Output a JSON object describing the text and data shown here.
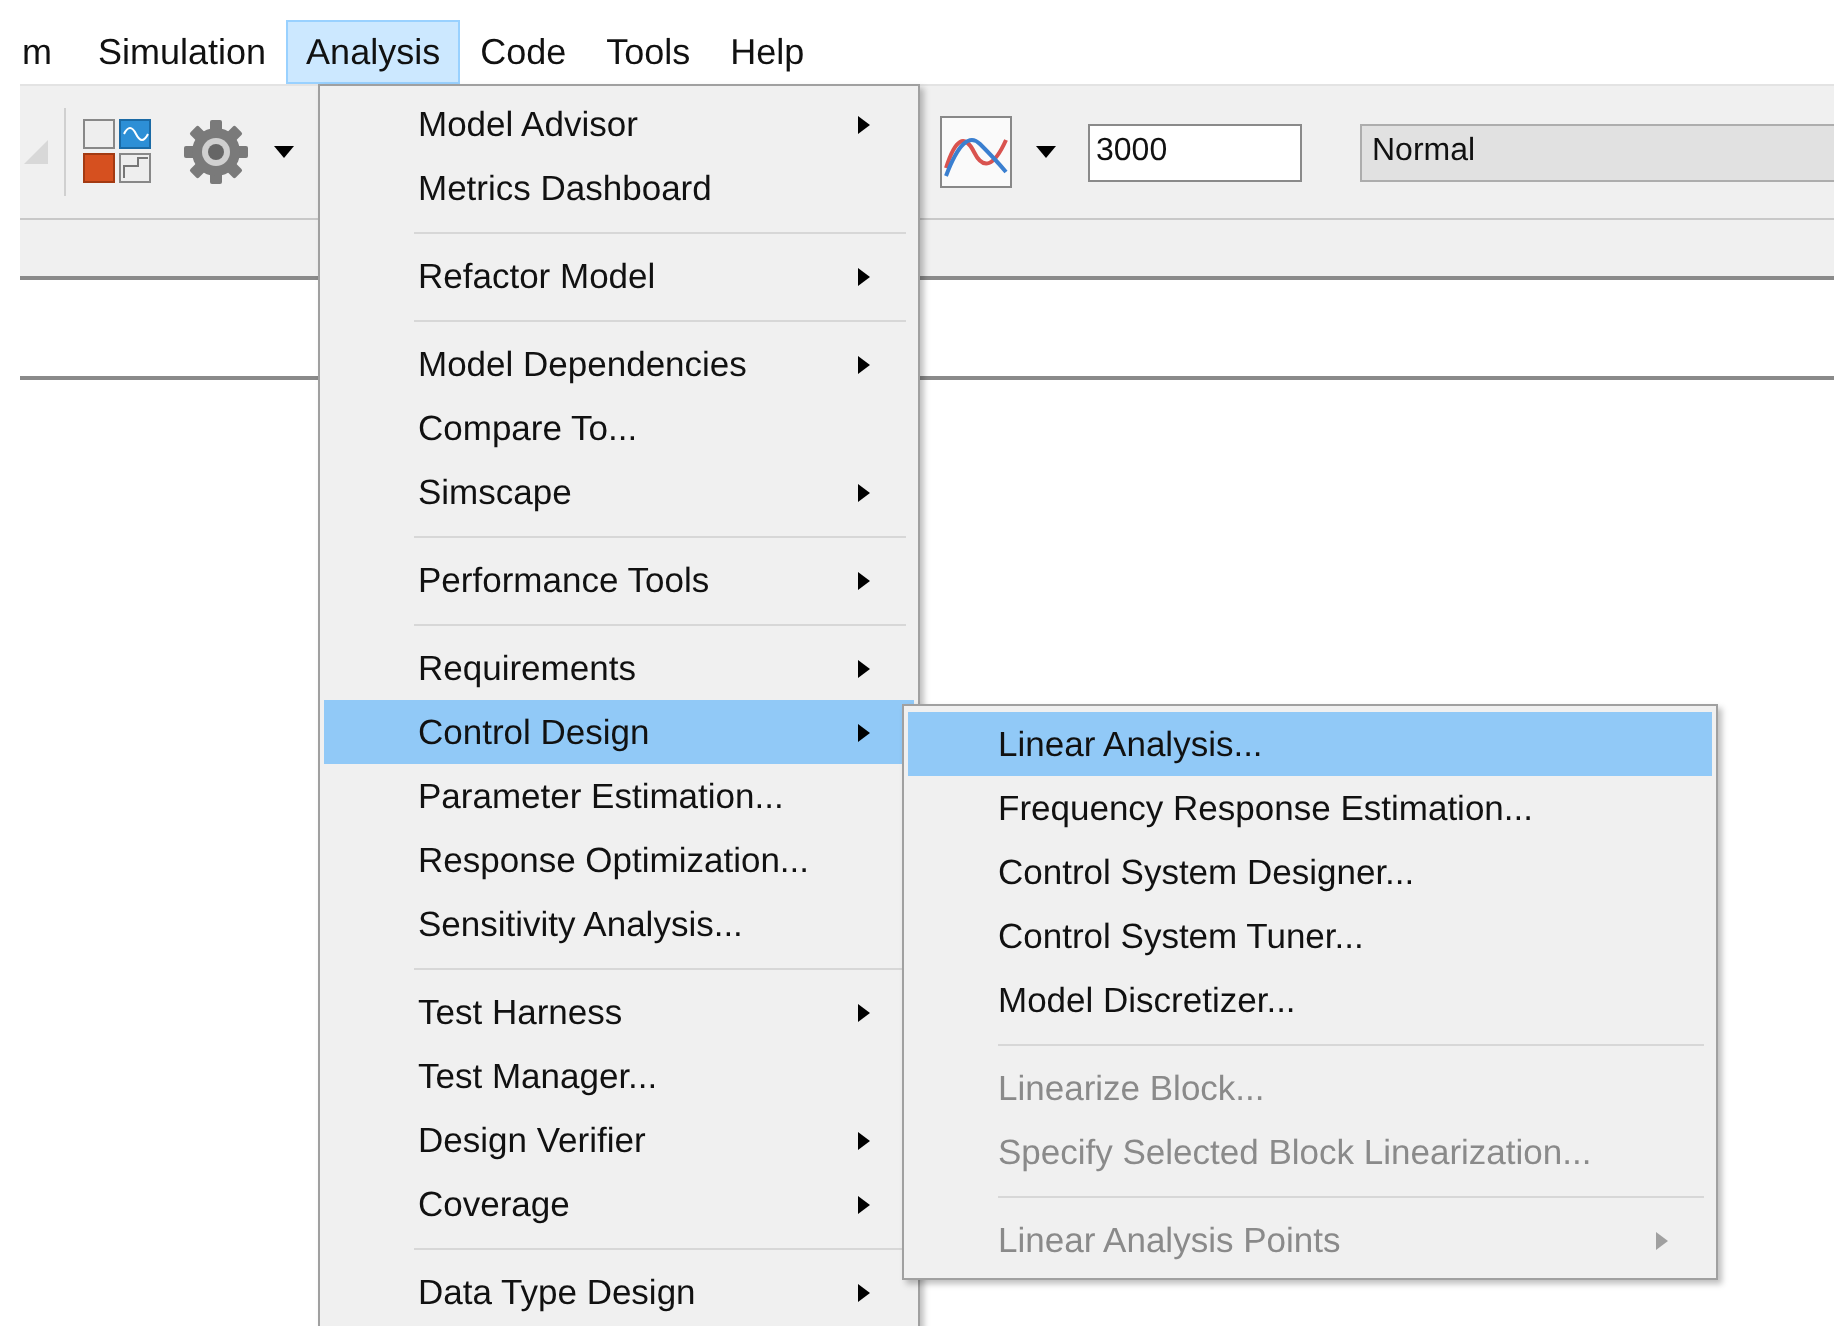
{
  "menubar": [
    {
      "label": "m",
      "selected": false
    },
    {
      "label": "Simulation",
      "selected": false
    },
    {
      "label": "Analysis",
      "selected": true
    },
    {
      "label": "Code",
      "selected": false
    },
    {
      "label": "Tools",
      "selected": false
    },
    {
      "label": "Help",
      "selected": false
    }
  ],
  "toolbar": {
    "stop_time": "3000",
    "simulation_mode": "Normal"
  },
  "menu": {
    "groups": [
      [
        {
          "label": "Model Advisor",
          "submenu": true,
          "selected": false,
          "disabled": false
        },
        {
          "label": "Metrics Dashboard",
          "submenu": false,
          "selected": false,
          "disabled": false
        }
      ],
      [
        {
          "label": "Refactor Model",
          "submenu": true,
          "selected": false,
          "disabled": false
        }
      ],
      [
        {
          "label": "Model Dependencies",
          "submenu": true,
          "selected": false,
          "disabled": false
        },
        {
          "label": "Compare To...",
          "submenu": false,
          "selected": false,
          "disabled": false
        },
        {
          "label": "Simscape",
          "submenu": true,
          "selected": false,
          "disabled": false
        }
      ],
      [
        {
          "label": "Performance Tools",
          "submenu": true,
          "selected": false,
          "disabled": false
        }
      ],
      [
        {
          "label": "Requirements",
          "submenu": true,
          "selected": false,
          "disabled": false
        },
        {
          "label": "Control Design",
          "submenu": true,
          "selected": true,
          "disabled": false
        },
        {
          "label": "Parameter Estimation...",
          "submenu": false,
          "selected": false,
          "disabled": false
        },
        {
          "label": "Response Optimization...",
          "submenu": false,
          "selected": false,
          "disabled": false
        },
        {
          "label": "Sensitivity Analysis...",
          "submenu": false,
          "selected": false,
          "disabled": false
        }
      ],
      [
        {
          "label": "Test Harness",
          "submenu": true,
          "selected": false,
          "disabled": false
        },
        {
          "label": "Test Manager...",
          "submenu": false,
          "selected": false,
          "disabled": false
        },
        {
          "label": "Design Verifier",
          "submenu": true,
          "selected": false,
          "disabled": false
        },
        {
          "label": "Coverage",
          "submenu": true,
          "selected": false,
          "disabled": false
        }
      ],
      [
        {
          "label": "Data Type Design",
          "submenu": true,
          "selected": false,
          "disabled": false
        }
      ]
    ]
  },
  "submenu": {
    "groups": [
      [
        {
          "label": "Linear Analysis...",
          "submenu": false,
          "selected": true,
          "disabled": false
        },
        {
          "label": "Frequency Response Estimation...",
          "submenu": false,
          "selected": false,
          "disabled": false
        },
        {
          "label": "Control System Designer...",
          "submenu": false,
          "selected": false,
          "disabled": false
        },
        {
          "label": "Control System Tuner...",
          "submenu": false,
          "selected": false,
          "disabled": false
        },
        {
          "label": "Model Discretizer...",
          "submenu": false,
          "selected": false,
          "disabled": false
        }
      ],
      [
        {
          "label": "Linearize Block...",
          "submenu": false,
          "selected": false,
          "disabled": true
        },
        {
          "label": "Specify Selected Block Linearization...",
          "submenu": false,
          "selected": false,
          "disabled": true
        }
      ],
      [
        {
          "label": "Linear Analysis Points",
          "submenu": true,
          "selected": false,
          "disabled": true
        }
      ]
    ]
  }
}
